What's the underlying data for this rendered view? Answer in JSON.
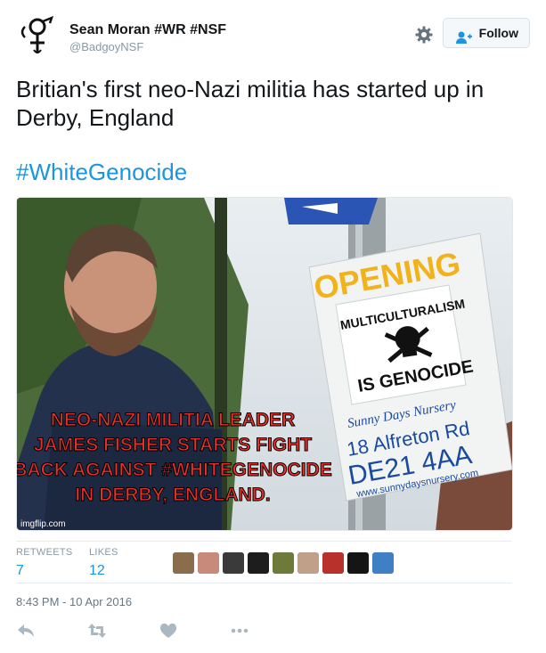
{
  "header": {
    "display_name": "Sean Moran #WR #NSF",
    "handle": "@BadgoyNSF",
    "follow_label": "Follow"
  },
  "tweet": {
    "text": "Britian's first neo-Nazi militia has started up in Derby, England",
    "hashtag": "#WhiteGenocide"
  },
  "media": {
    "overlay_lines": [
      "NEO-NAZI MILITIA LEADER",
      "JAMES FISHER STARTS FIGHT",
      "BACK AGAINST #WHITEGENOCIDE",
      "IN DERBY, ENGLAND."
    ],
    "watermark": "imgflip.com",
    "sign": {
      "opening": "OPENING",
      "sticker_top": "MULTICULTURALISM",
      "sticker_bottom": "IS GENOCIDE",
      "nursery": "Sunny Days Nursery",
      "address": "18 Alfreton Rd",
      "postcode": "DE21 4AA",
      "website": "www.sunnydaysnursery.com"
    }
  },
  "stats": {
    "retweets_label": "RETWEETS",
    "retweets_value": "7",
    "likes_label": "LIKES",
    "likes_value": "12"
  },
  "timestamp": "8:43 PM - 10 Apr 2016",
  "colors": {
    "link_blue": "#1b95e0",
    "overlay_red": "#e8312a",
    "muted_gray": "#8899a6"
  },
  "icons": {
    "reply": "reply-icon",
    "retweet": "retweet-icon",
    "like": "heart-icon",
    "more": "more-icon",
    "settings": "gear-icon"
  }
}
